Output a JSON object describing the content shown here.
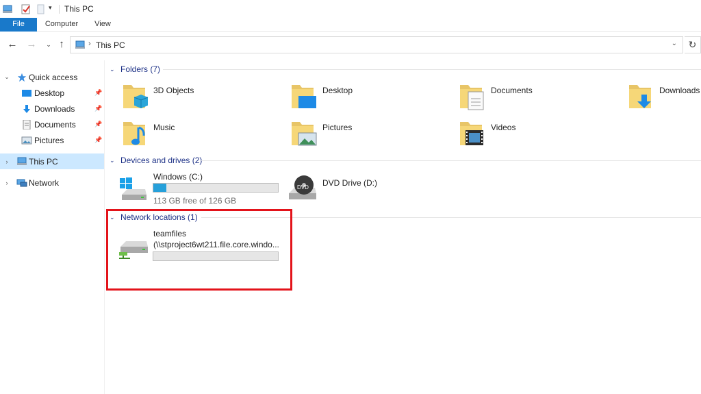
{
  "window": {
    "title": "This PC"
  },
  "ribbon": {
    "tabs": [
      "File",
      "Computer",
      "View"
    ]
  },
  "address": {
    "crumb": "This PC"
  },
  "navigation": {
    "quick_access": "Quick access",
    "quick_items": [
      "Desktop",
      "Downloads",
      "Documents",
      "Pictures"
    ],
    "this_pc": "This PC",
    "network": "Network"
  },
  "groups": {
    "folders": "Folders (7)",
    "devices": "Devices and drives (2)",
    "network_locations": "Network locations (1)"
  },
  "folders": [
    "3D Objects",
    "Desktop",
    "Documents",
    "Downloads",
    "Music",
    "Pictures",
    "Videos"
  ],
  "drives": {
    "c": {
      "name": "Windows (C:)",
      "free": "113 GB free of 126 GB",
      "used_fraction": 0.103
    },
    "d": {
      "name": "DVD Drive (D:)"
    }
  },
  "network_locations": {
    "name": "teamfiles",
    "path": "(\\\\stproject6wt211.file.core.windo..."
  },
  "colors": {
    "accent": "#1979ca",
    "selection": "#cce8ff",
    "highlight": "#e3131a",
    "group_header": "#1e3287",
    "bar_fill": "#26a0da"
  }
}
